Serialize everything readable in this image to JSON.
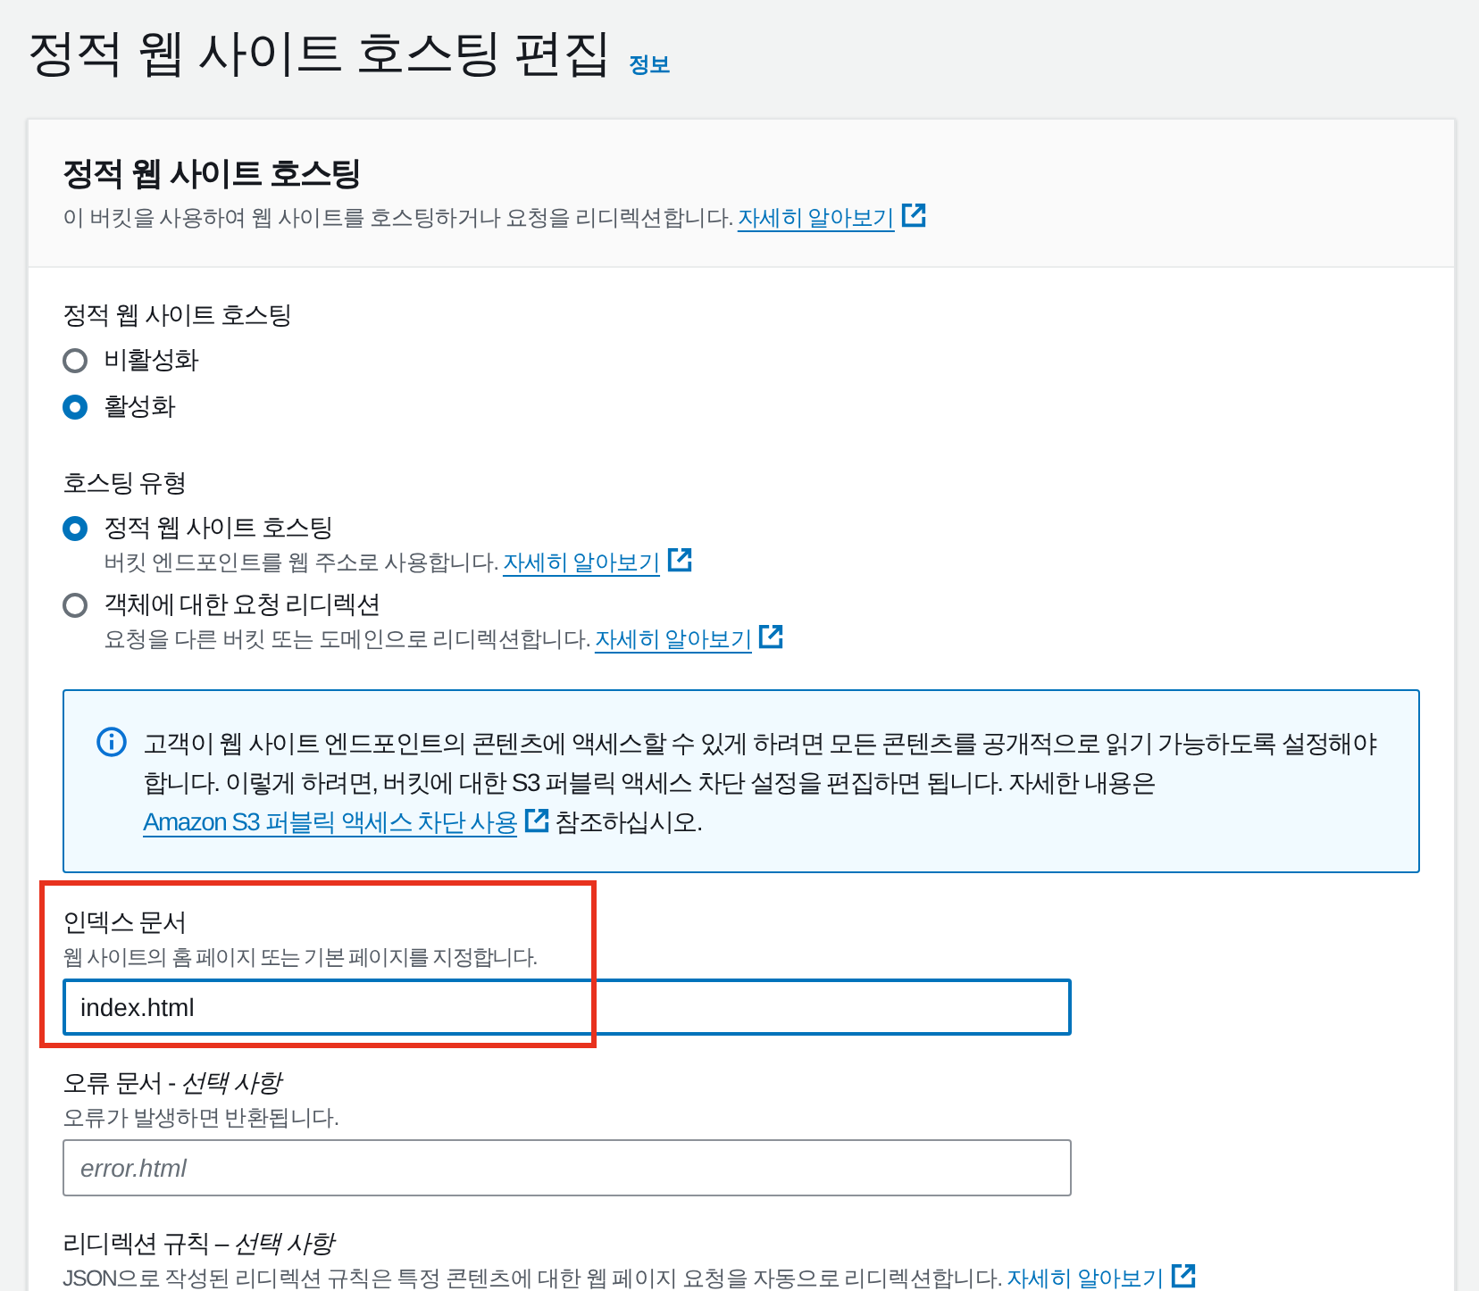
{
  "page": {
    "title": "정적 웹 사이트 호스팅 편집",
    "info_link": "정보"
  },
  "panel": {
    "title": "정적 웹 사이트 호스팅",
    "description": "이 버킷을 사용하여 웹 사이트를 호스팅하거나 요청을 리디렉션합니다.",
    "link": "자세히 알아보기"
  },
  "hosting": {
    "label": "정적 웹 사이트 호스팅",
    "options": [
      {
        "label": "비활성화",
        "selected": false
      },
      {
        "label": "활성화",
        "selected": true
      }
    ]
  },
  "hosting_type": {
    "label": "호스팅 유형",
    "options": [
      {
        "label": "정적 웹 사이트 호스팅",
        "description": "버킷 엔드포인트를 웹 주소로 사용합니다.",
        "link": "자세히 알아보기",
        "selected": true
      },
      {
        "label": "객체에 대한 요청 리디렉션",
        "description": "요청을 다른 버킷 또는 도메인으로 리디렉션합니다.",
        "link": "자세히 알아보기",
        "selected": false
      }
    ]
  },
  "info_alert": {
    "text": "고객이 웹 사이트 엔드포인트의 콘텐츠에 액세스할 수 있게 하려면 모든 콘텐츠를 공개적으로 읽기 가능하도록 설정해야 합니다. 이렇게 하려면, 버킷에 대한 S3 퍼블릭 액세스 차단 설정을 편집하면 됩니다. 자세한 내용은",
    "link": "Amazon S3 퍼블릭 액세스 차단 사용",
    "text_after": "참조하십시오."
  },
  "index_document": {
    "label": "인덱스 문서",
    "description": "웹 사이트의 홈 페이지 또는 기본 페이지를 지정합니다.",
    "value": "index.html",
    "focused": true,
    "highlighted": true
  },
  "error_document": {
    "label": "오류 문서 - *선택 사항*",
    "description": "오류가 발생하면 반환됩니다.",
    "placeholder": "error.html",
    "focused": false
  },
  "redirection_rules": {
    "label": "리디렉션 규칙 – *선택 사항*",
    "description": "JSON으로 작성된 리디렉션 규칙은 특정 콘텐츠에 대한 웹 페이지 요청을 자동으로 리디렉션합니다.",
    "link": "자세히 알아보기"
  }
}
